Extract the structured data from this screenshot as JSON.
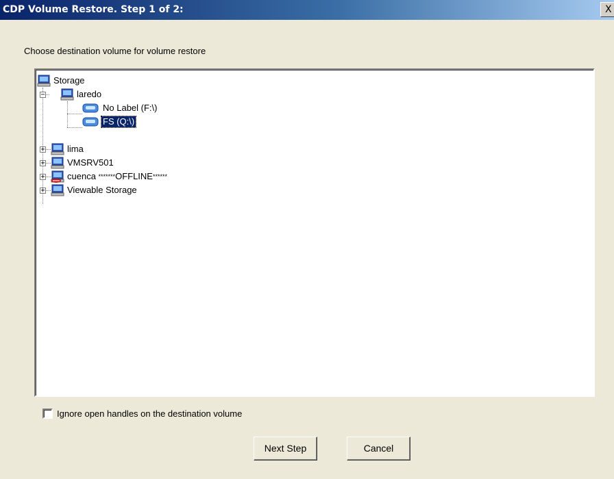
{
  "window": {
    "title": "CDP Volume Restore. Step 1 of 2:",
    "close_label": "X"
  },
  "instruction": "Choose destination volume for volume restore",
  "tree": {
    "root": "Storage",
    "laredo": {
      "label": "laredo",
      "expanded": true,
      "children": [
        "No Label (F:\\)",
        "FS (Q:\\)"
      ],
      "selected_child": "FS (Q:\\)"
    },
    "lima": "lima",
    "vmsrv501": "VMSRV501",
    "cuenca": {
      "name": "cuenca ",
      "stars_before": "*******",
      "status": "OFFLINE",
      "stars_after": "******"
    },
    "viewable": "Viewable Storage",
    "expander_collapsed": "+",
    "expander_expanded": "−"
  },
  "options": {
    "ignore_open_handles_label": "Ignore open handles on the destination volume",
    "ignore_open_handles_checked": false
  },
  "buttons": {
    "next_label": "Next Step",
    "cancel_label": "Cancel"
  },
  "icons": {
    "computer": "computer-icon",
    "computer_offline": "computer-offline-icon",
    "disk": "disk-volume-icon",
    "root": "storage-root-icon"
  }
}
